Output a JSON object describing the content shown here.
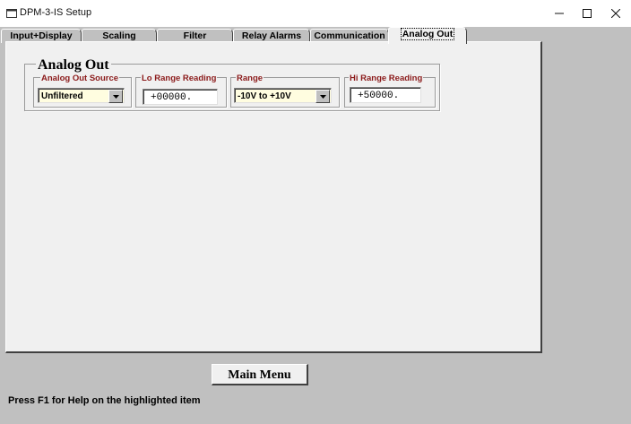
{
  "window": {
    "title": "DPM-3-IS Setup"
  },
  "tabs": [
    {
      "label": "Input+Display"
    },
    {
      "label": "Scaling"
    },
    {
      "label": "Filter"
    },
    {
      "label": "Relay Alarms"
    },
    {
      "label": "Communication"
    },
    {
      "label": "Analog Out",
      "active": true
    }
  ],
  "analog_out": {
    "title": "Analog Out",
    "source": {
      "label": "Analog Out Source",
      "value": "Unfiltered"
    },
    "lo_range": {
      "label": "Lo Range Reading",
      "value": "+00000."
    },
    "range": {
      "label": "Range",
      "value": "-10V to +10V"
    },
    "hi_range": {
      "label": "Hi Range Reading",
      "value": "+50000."
    }
  },
  "footer": {
    "main_menu_label": "Main Menu",
    "help_text": "Press F1 for Help on the highlighted item"
  },
  "colors": {
    "label_red": "#8b1a1a",
    "combo_bg": "#fffde0",
    "panel_bg": "#f0f0f0",
    "window_bg": "#c0c0c0"
  }
}
